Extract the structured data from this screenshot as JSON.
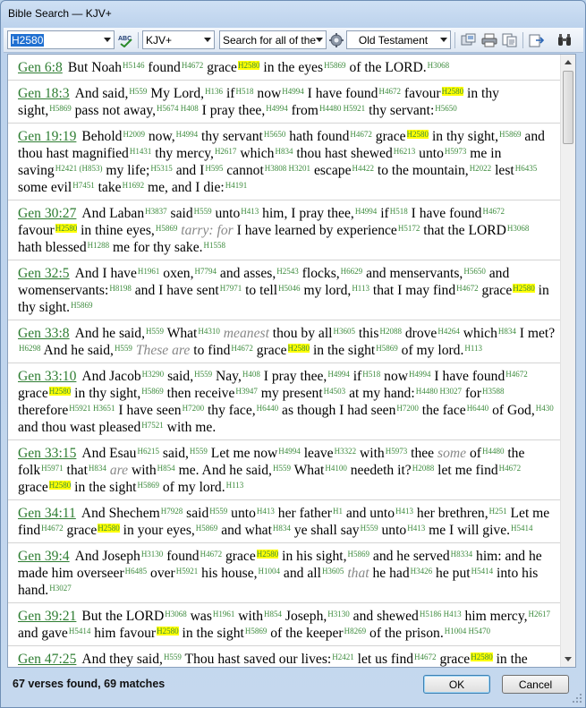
{
  "window": {
    "title": "Bible Search — KJV+"
  },
  "toolbar": {
    "search_text": "H2580",
    "bible_version": "KJV+",
    "search_mode": "Search for all of the",
    "scope": "Old Testament",
    "icons": [
      "spellcheck-icon",
      "options-gear-icon",
      "copy-icon",
      "print-icon",
      "copy-text-icon",
      "export-icon",
      "binoculars-icon"
    ]
  },
  "colors": {
    "reference": "#2e7d32",
    "strongs": "#3d8b3d",
    "highlight": "#ffff00"
  },
  "verses": [
    {
      "ref": "Gen 6:8",
      "text": "But Noah[H5146] found[H4672] grace[H2580*] in the eyes[H5869] of the LORD.[H3068]"
    },
    {
      "ref": "Gen 18:3",
      "text": "And said,[H559] My Lord,[H136] if[H518] now[H4994] I have found[H4672] favour[H2580*] in thy sight,[H5869] pass not away,[H5674 H408] I pray thee,[H4994] from[H4480 H5921] thy servant:[H5650]"
    },
    {
      "ref": "Gen 19:19",
      "text": "Behold[H2009] now,[H4994] thy servant[H5650] hath found[H4672] grace[H2580*] in thy sight,[H5869] and thou hast magnified[H1431] thy mercy,[H2617] which[H834] thou hast shewed[H6213] unto[H5973] me in saving[H2421 (H853)] my life;[H5315] and I[H595] cannot[H3808 H3201] escape[H4422] to the mountain,[H2022] lest[H6435] some evil[H7451] take[H1692] me, and I die:[H4191]"
    },
    {
      "ref": "Gen 30:27",
      "text": "And Laban[H3837] said[H559] unto[H413] him, I pray thee,[H4994] if[H518] I have found[H4672] favour[H2580*] in thine eyes,[H5869] {tarry: for} I have learned by experience[H5172] that the LORD[H3068] hath blessed[H1288] me for thy sake.[H1558]"
    },
    {
      "ref": "Gen 32:5",
      "text": "And I have[H1961] oxen,[H7794] and asses,[H2543] flocks,[H6629] and menservants,[H5650] and womenservants:[H8198] and I have sent[H7971] to tell[H5046] my lord,[H113] that I may find[H4672] grace[H2580*] in thy sight.[H5869]"
    },
    {
      "ref": "Gen 33:8",
      "text": "And he said,[H559] What[H4310] {meanest} thou by all[H3605] this[H2088] drove[H4264] which[H834] I met?[H6298] And he said,[H559] {These are} to find[H4672] grace[H2580*] in the sight[H5869] of my lord.[H113]"
    },
    {
      "ref": "Gen 33:10",
      "text": "And Jacob[H3290] said,[H559] Nay,[H408] I pray thee,[H4994] if[H518] now[H4994] I have found[H4672] grace[H2580*] in thy sight,[H5869] then receive[H3947] my present[H4503] at my hand:[H4480 H3027] for[H3588] therefore[H5921 H3651] I have seen[H7200] thy face,[H6440] as though I had seen[H7200] the face[H6440] of God,[H430] and thou wast pleased[H7521] with me."
    },
    {
      "ref": "Gen 33:15",
      "text": "And Esau[H6215] said,[H559] Let me now[H4994] leave[H3322] with[H5973] thee {some} of[H4480] the folk[H5971] that[H834] {are} with[H854] me. And he said,[H559] What[H4100] needeth it?[H2088] let me find[H4672] grace[H2580*] in the sight[H5869] of my lord.[H113]"
    },
    {
      "ref": "Gen 34:11",
      "text": "And Shechem[H7928] said[H559] unto[H413] her father[H1] and unto[H413] her brethren,[H251] Let me find[H4672] grace[H2580*] in your eyes,[H5869] and what[H834] ye shall say[H559] unto[H413] me I will give.[H5414]"
    },
    {
      "ref": "Gen 39:4",
      "text": "And Joseph[H3130] found[H4672] grace[H2580*] in his sight,[H5869] and he served[H8334] him: and he made him overseer[H6485] over[H5921] his house,[H1004] and all[H3605] {that} he had[H3426] he put[H5414] into his hand.[H3027]"
    },
    {
      "ref": "Gen 39:21",
      "text": "But the LORD[H3068] was[H1961] with[H854] Joseph,[H3130] and shewed[H5186 H413] him mercy,[H2617] and gave[H5414] him favour[H2580*] in the sight[H5869] of the keeper[H8269] of the prison.[H1004 H5470]"
    },
    {
      "ref": "Gen 47:25",
      "text": "And they said,[H559] Thou hast saved our lives:[H2421] let us find[H4672] grace[H2580*] in the sight of my lord, and we will be Pharaoh's servants."
    }
  ],
  "status": {
    "summary": "67 verses found, 69 matches"
  },
  "buttons": {
    "ok": "OK",
    "cancel": "Cancel"
  }
}
